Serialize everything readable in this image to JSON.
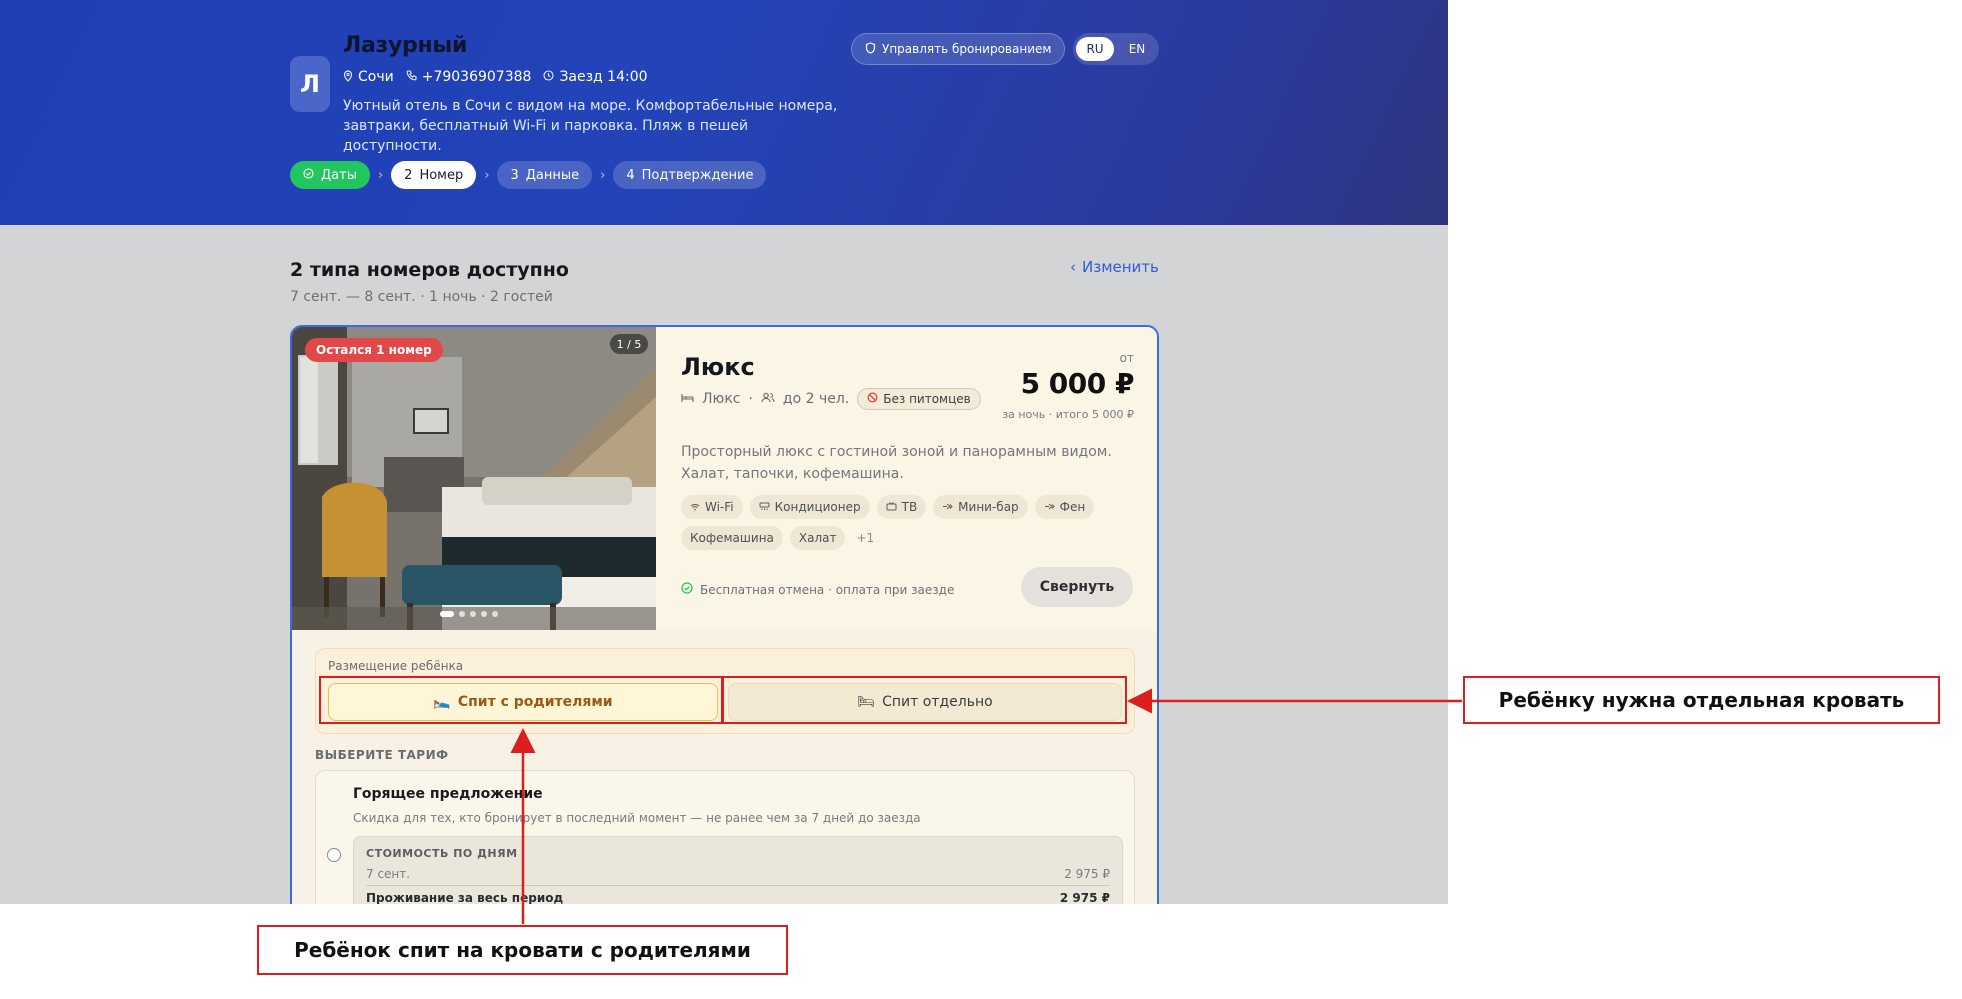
{
  "hotel": {
    "initial": "Л",
    "name": "Лазурный",
    "city": "Сочи",
    "phone": "+79036907388",
    "checkin": "Заезд 14:00",
    "description": "Уютный отель в Сочи с видом на море. Комфортабельные номера, завтраки, бесплатный Wi-Fi и парковка. Пляж в пешей доступности."
  },
  "header": {
    "manage_label": "Управлять бронированием",
    "lang_ru": "RU",
    "lang_en": "EN"
  },
  "steps": [
    {
      "label": "Даты",
      "status": "done"
    },
    {
      "num": "2",
      "label": "Номер",
      "status": "active"
    },
    {
      "num": "3",
      "label": "Данные",
      "status": "pending"
    },
    {
      "num": "4",
      "label": "Подтверждение",
      "status": "pending"
    }
  ],
  "results": {
    "title": "2 типа номеров доступно",
    "subtitle": "7 сент. — 8 сент. · 1 ночь · 2 гостей",
    "change_label": "Изменить"
  },
  "room": {
    "badge": "Остался 1 номер",
    "photo_counter": "1 / 5",
    "photo_count": 5,
    "active_photo": 1,
    "name": "Люкс",
    "category": "Люкс",
    "capacity": "до 2 чел.",
    "pets": "Без питомцев",
    "price_from": "от",
    "price": "5 000 ₽",
    "price_sub": "за ночь · итого 5 000 ₽",
    "description": "Просторный люкс с гостиной зоной и панорамным видом. Халат, тапочки, кофемашина.",
    "amenities": [
      "Wi-Fi",
      "Кондиционер",
      "ТВ",
      "Мини-бар",
      "Фен",
      "Кофемашина",
      "Халат"
    ],
    "amenities_more": "+1",
    "cancel_note": "Бесплатная отмена · оплата при заезде",
    "collapse_label": "Свернуть"
  },
  "child": {
    "label": "Размещение ребёнка",
    "with_parents": "Спит с родителями",
    "separate": "Спит отдельно",
    "selected": "with_parents"
  },
  "tariff": {
    "section_label": "ВЫБЕРИТЕ ТАРИФ",
    "name": "Горящее предложение",
    "description": "Скидка для тех, кто бронирует в последний момент — не ранее чем за 7 дней до заезда",
    "breakdown_title": "СТОИМОСТЬ ПО ДНЯМ",
    "day_label": "7 сент.",
    "day_value": "2 975 ₽",
    "total_label": "Проживание за весь период",
    "total_value": "2 975 ₽"
  },
  "annotations": {
    "separate": "Ребёнку нужна отдельная кровать",
    "with_parents": "Ребёнок спит на кровати с родителями"
  },
  "colors": {
    "accent": "#2f5cd6",
    "step_done": "#22c55e",
    "badge_red": "#e24848",
    "annotation": "#d91f1f"
  }
}
